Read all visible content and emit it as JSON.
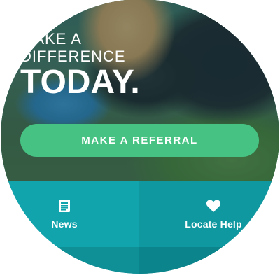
{
  "hero": {
    "tagline_line1": "MAKE A",
    "tagline_line2": "DIFFERENCE",
    "tagline_line3": "TODAY."
  },
  "cta": {
    "label": "MAKE A REFERRAL"
  },
  "tiles": [
    {
      "label": "News",
      "icon": "newspaper-icon"
    },
    {
      "label": "Locate Help",
      "icon": "heart-icon"
    }
  ],
  "colors": {
    "cta": "#46c383",
    "tile_news": "#12a4ac",
    "tile_locate": "#0f98a0",
    "text": "#ffffff"
  }
}
